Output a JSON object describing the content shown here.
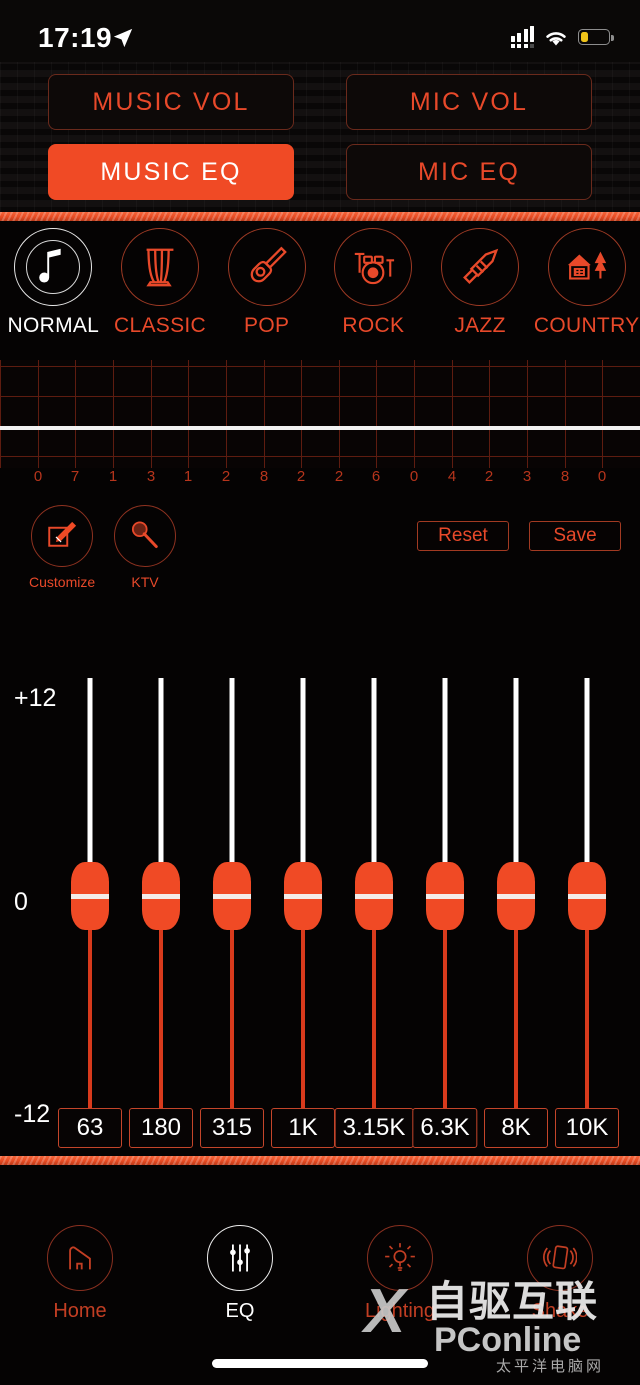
{
  "status_bar": {
    "time": "17:19",
    "location_icon": "location-arrow-icon",
    "signal_icon": "cellular-signal-icon",
    "wifi_icon": "wifi-icon",
    "battery_icon": "battery-low-icon",
    "battery_percent": 25
  },
  "header": {
    "buttons": [
      {
        "label": "MUSIC  VOL",
        "active": false,
        "name": "music-vol-button"
      },
      {
        "label": "MIC  VOL",
        "active": false,
        "name": "mic-vol-button"
      },
      {
        "label": "MUSIC  EQ",
        "active": true,
        "name": "music-eq-button"
      },
      {
        "label": "MIC  EQ",
        "active": false,
        "name": "mic-eq-button"
      }
    ]
  },
  "presets": [
    {
      "label": "NORMAL",
      "icon": "music-note-icon",
      "active": true
    },
    {
      "label": "CLASSIC",
      "icon": "harp-icon",
      "active": false
    },
    {
      "label": "POP",
      "icon": "guitar-icon",
      "active": false
    },
    {
      "label": "ROCK",
      "icon": "drums-icon",
      "active": false
    },
    {
      "label": "JAZZ",
      "icon": "trumpet-icon",
      "active": false
    },
    {
      "label": "COUNTRY",
      "icon": "house-tree-icon",
      "active": false
    }
  ],
  "curve": {
    "axis_labels": [
      "0",
      "7",
      "1",
      "3",
      "1",
      "2",
      "8",
      "2",
      "2",
      "6",
      "0",
      "4",
      "2",
      "3",
      "8",
      "0"
    ],
    "grid_columns": 17,
    "curve_position": "flat-center"
  },
  "tools": {
    "customize": {
      "label": "Customize",
      "icon": "pencil-edit-icon"
    },
    "ktv": {
      "label": "KTV",
      "icon": "microphone-icon"
    },
    "reset_label": "Reset",
    "save_label": "Save"
  },
  "equalizer": {
    "scale_top": "+12",
    "scale_mid": "0",
    "scale_bottom": "-12",
    "bands": [
      {
        "freq": "63",
        "value": 0
      },
      {
        "freq": "180",
        "value": 0
      },
      {
        "freq": "315",
        "value": 0
      },
      {
        "freq": "1K",
        "value": 0
      },
      {
        "freq": "3.15K",
        "value": 0
      },
      {
        "freq": "6.3K",
        "value": 0
      },
      {
        "freq": "8K",
        "value": 0
      },
      {
        "freq": "10K",
        "value": 0
      }
    ]
  },
  "bottom_nav": [
    {
      "label": "Home",
      "icon": "home-icon",
      "active": false
    },
    {
      "label": "EQ",
      "icon": "sliders-icon",
      "active": true
    },
    {
      "label": "Lighting",
      "icon": "lightbulb-icon",
      "active": false
    },
    {
      "label": "Shake",
      "icon": "shake-phone-icon",
      "active": false
    }
  ],
  "watermark": {
    "x_mark": "X",
    "cn_text": "自驱互联",
    "brand": "PConline",
    "sub": "太平洋电脑网"
  },
  "colors": {
    "accent": "#f04a25",
    "accent_dim": "#e8492a",
    "border": "#8e3220",
    "background": "#050303",
    "white": "#ffffff"
  }
}
